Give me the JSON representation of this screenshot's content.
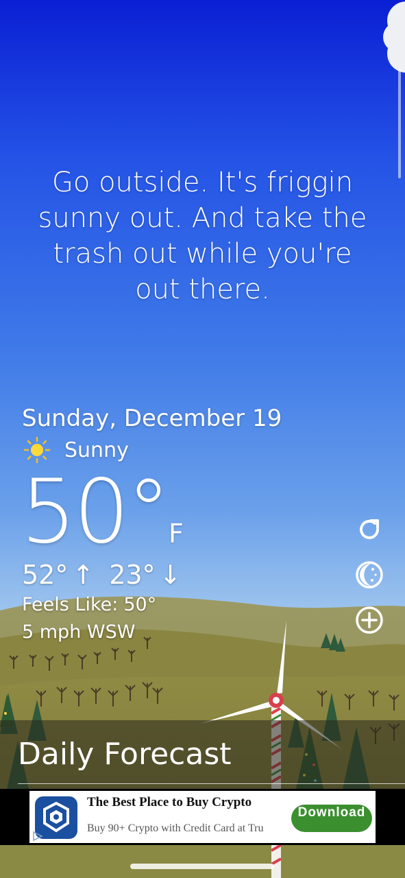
{
  "quote": "Go outside. It's friggin sunny out. And take the trash out while you're out there.",
  "weather": {
    "date": "Sunday, December 19",
    "condition": "Sunny",
    "condition_icon": "sun-icon",
    "temperature": "50°",
    "unit": "F",
    "high": "52°",
    "high_arrow": "↑",
    "low": "23°",
    "low_arrow": "↓",
    "feels_like_label": "Feels Like:",
    "feels_like_value": "50°",
    "wind": "5 mph WSW"
  },
  "side_actions": [
    {
      "name": "refresh-icon"
    },
    {
      "name": "moon-icon"
    },
    {
      "name": "add-location-icon"
    }
  ],
  "forecast": {
    "title": "Daily Forecast"
  },
  "ad": {
    "title": "The Best Place to Buy Crypto",
    "subtitle": "Buy 90+ Crypto with Credit Card at Tru",
    "cta": "Download",
    "logo_color": "#1b4fa0",
    "cta_color": "#3b8f2f"
  }
}
